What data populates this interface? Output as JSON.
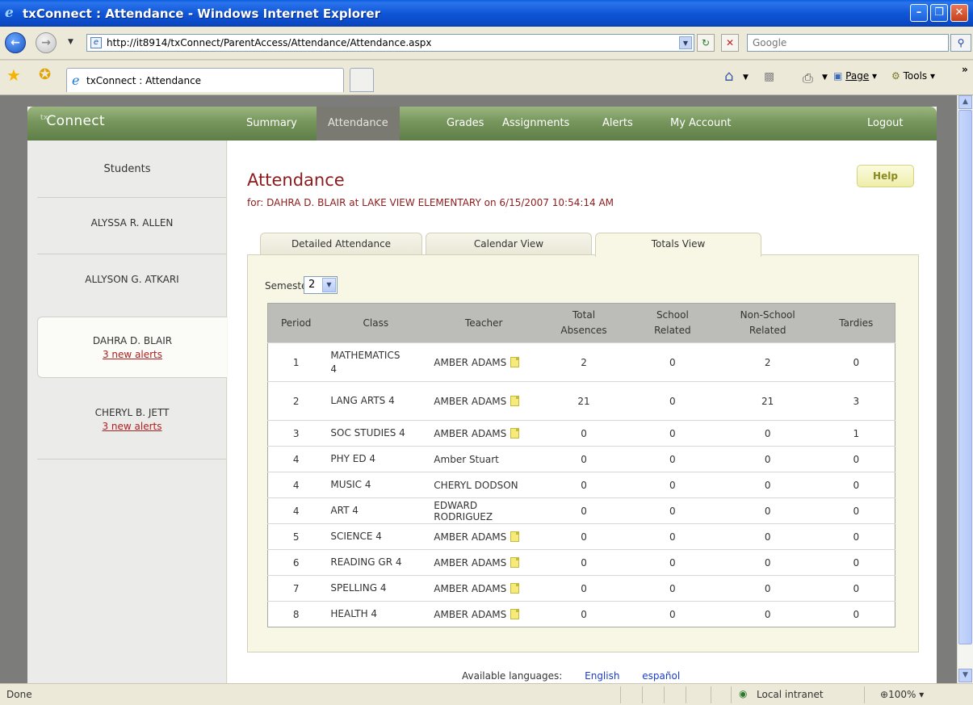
{
  "window": {
    "title": "txConnect : Attendance - Windows Internet Explorer",
    "url": "http://it8914/txConnect/ParentAccess/Attendance/Attendance.aspx",
    "search_placeholder": "Google",
    "tab_title": "txConnect : Attendance",
    "page_menu": "Page",
    "tools_menu": "Tools",
    "status_text": "Done",
    "zone": "Local intranet",
    "zoom": "100%"
  },
  "app": {
    "logo": "Connect",
    "logo_prefix": "tx",
    "nav": [
      "Summary",
      "Attendance",
      "Grades",
      "Assignments",
      "Alerts",
      "My Account"
    ],
    "nav_active": "Attendance",
    "logout": "Logout"
  },
  "sidebar": {
    "heading": "Students",
    "students": [
      {
        "name": "ALYSSA R. ALLEN",
        "alerts": ""
      },
      {
        "name": "ALLYSON G. ATKARI",
        "alerts": ""
      },
      {
        "name": "DAHRA D. BLAIR",
        "alerts": "3 new alerts"
      },
      {
        "name": "CHERYL B. JETT",
        "alerts": "3 new alerts"
      }
    ],
    "selected": "DAHRA D. BLAIR"
  },
  "main": {
    "title": "Attendance",
    "subtitle": "for: DAHRA D. BLAIR at LAKE VIEW ELEMENTARY on 6/15/2007 10:54:14 AM",
    "help": "Help",
    "tabs": [
      "Detailed Attendance",
      "Calendar View",
      "Totals View"
    ],
    "active_tab": "Totals View",
    "semester_label": "Semester:",
    "semester_value": "2",
    "columns": [
      "Period",
      "Class",
      "Teacher",
      "Total Absences",
      "School Related",
      "Non-School Related",
      "Tardies"
    ],
    "rows": [
      {
        "period": "1",
        "class": "MATHEMATICS 4",
        "teacher": "AMBER ADAMS",
        "note": true,
        "total": "2",
        "school": "0",
        "nonschool": "2",
        "tardies": "0"
      },
      {
        "period": "2",
        "class": "LANG ARTS 4",
        "teacher": "AMBER ADAMS",
        "note": true,
        "total": "21",
        "school": "0",
        "nonschool": "21",
        "tardies": "3"
      },
      {
        "period": "3",
        "class": "SOC STUDIES 4",
        "teacher": "AMBER ADAMS",
        "note": true,
        "total": "0",
        "school": "0",
        "nonschool": "0",
        "tardies": "1"
      },
      {
        "period": "4",
        "class": "PHY ED 4",
        "teacher": "Amber Stuart",
        "note": false,
        "total": "0",
        "school": "0",
        "nonschool": "0",
        "tardies": "0"
      },
      {
        "period": "4",
        "class": "MUSIC 4",
        "teacher": "CHERYL DODSON",
        "note": false,
        "total": "0",
        "school": "0",
        "nonschool": "0",
        "tardies": "0"
      },
      {
        "period": "4",
        "class": "ART 4",
        "teacher": "EDWARD RODRIGUEZ",
        "note": false,
        "total": "0",
        "school": "0",
        "nonschool": "0",
        "tardies": "0"
      },
      {
        "period": "5",
        "class": "SCIENCE 4",
        "teacher": "AMBER ADAMS",
        "note": true,
        "total": "0",
        "school": "0",
        "nonschool": "0",
        "tardies": "0"
      },
      {
        "period": "6",
        "class": "READING GR 4",
        "teacher": "AMBER ADAMS",
        "note": true,
        "total": "0",
        "school": "0",
        "nonschool": "0",
        "tardies": "0"
      },
      {
        "period": "7",
        "class": "SPELLING 4",
        "teacher": "AMBER ADAMS",
        "note": true,
        "total": "0",
        "school": "0",
        "nonschool": "0",
        "tardies": "0"
      },
      {
        "period": "8",
        "class": "HEALTH 4",
        "teacher": "AMBER ADAMS",
        "note": true,
        "total": "0",
        "school": "0",
        "nonschool": "0",
        "tardies": "0"
      }
    ],
    "languages_label": "Available languages:",
    "languages": [
      "English",
      "español"
    ]
  },
  "colors": {
    "nav_green": "#76965d",
    "title_red": "#8c1c1c",
    "alert_red": "#b02020",
    "panel_cream": "#f8f7e6"
  },
  "icons": {
    "note": "note-icon",
    "back": "back-arrow-icon",
    "forward": "forward-arrow-icon",
    "home": "home-icon",
    "feeds": "rss-icon",
    "print": "print-icon",
    "favorites": "star-icon"
  }
}
